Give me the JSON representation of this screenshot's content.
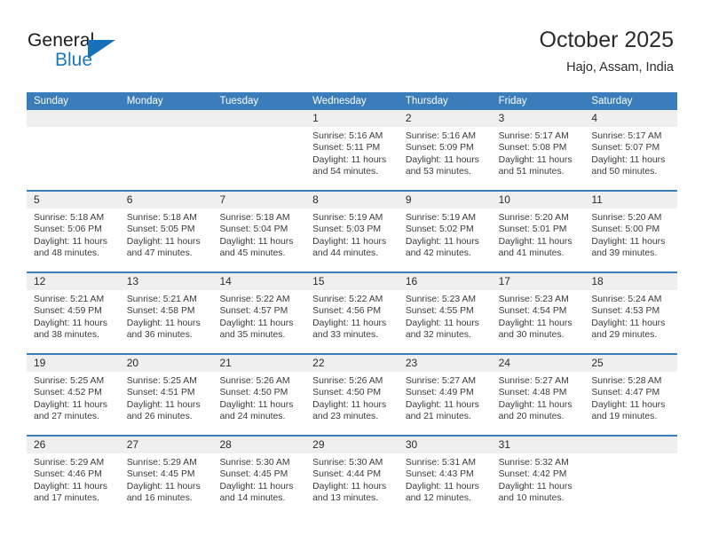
{
  "brand": {
    "name_top": "General",
    "name_bottom": "Blue",
    "accent_color": "#1571b8",
    "text_color": "#1a1a1a"
  },
  "header": {
    "title": "October 2025",
    "subtitle": "Hajo, Assam, India"
  },
  "theme": {
    "header_blue": "#3b7cba",
    "date_band_gray": "#efefef",
    "body_white": "#ffffff",
    "text_dark": "#2b2b2b",
    "text_body": "#3b3b3b"
  },
  "weekdays": [
    "Sunday",
    "Monday",
    "Tuesday",
    "Wednesday",
    "Thursday",
    "Friday",
    "Saturday"
  ],
  "labels": {
    "sunrise_prefix": "Sunrise:",
    "sunset_prefix": "Sunset:",
    "daylight_prefix": "Daylight:"
  },
  "weeks": [
    {
      "dates": [
        "",
        "",
        "",
        "1",
        "2",
        "3",
        "4"
      ],
      "cells": [
        null,
        null,
        null,
        {
          "sunrise": "Sunrise: 5:16 AM",
          "sunset": "Sunset: 5:11 PM",
          "daylight": "Daylight: 11 hours and 54 minutes."
        },
        {
          "sunrise": "Sunrise: 5:16 AM",
          "sunset": "Sunset: 5:09 PM",
          "daylight": "Daylight: 11 hours and 53 minutes."
        },
        {
          "sunrise": "Sunrise: 5:17 AM",
          "sunset": "Sunset: 5:08 PM",
          "daylight": "Daylight: 11 hours and 51 minutes."
        },
        {
          "sunrise": "Sunrise: 5:17 AM",
          "sunset": "Sunset: 5:07 PM",
          "daylight": "Daylight: 11 hours and 50 minutes."
        }
      ]
    },
    {
      "dates": [
        "5",
        "6",
        "7",
        "8",
        "9",
        "10",
        "11"
      ],
      "cells": [
        {
          "sunrise": "Sunrise: 5:18 AM",
          "sunset": "Sunset: 5:06 PM",
          "daylight": "Daylight: 11 hours and 48 minutes."
        },
        {
          "sunrise": "Sunrise: 5:18 AM",
          "sunset": "Sunset: 5:05 PM",
          "daylight": "Daylight: 11 hours and 47 minutes."
        },
        {
          "sunrise": "Sunrise: 5:18 AM",
          "sunset": "Sunset: 5:04 PM",
          "daylight": "Daylight: 11 hours and 45 minutes."
        },
        {
          "sunrise": "Sunrise: 5:19 AM",
          "sunset": "Sunset: 5:03 PM",
          "daylight": "Daylight: 11 hours and 44 minutes."
        },
        {
          "sunrise": "Sunrise: 5:19 AM",
          "sunset": "Sunset: 5:02 PM",
          "daylight": "Daylight: 11 hours and 42 minutes."
        },
        {
          "sunrise": "Sunrise: 5:20 AM",
          "sunset": "Sunset: 5:01 PM",
          "daylight": "Daylight: 11 hours and 41 minutes."
        },
        {
          "sunrise": "Sunrise: 5:20 AM",
          "sunset": "Sunset: 5:00 PM",
          "daylight": "Daylight: 11 hours and 39 minutes."
        }
      ]
    },
    {
      "dates": [
        "12",
        "13",
        "14",
        "15",
        "16",
        "17",
        "18"
      ],
      "cells": [
        {
          "sunrise": "Sunrise: 5:21 AM",
          "sunset": "Sunset: 4:59 PM",
          "daylight": "Daylight: 11 hours and 38 minutes."
        },
        {
          "sunrise": "Sunrise: 5:21 AM",
          "sunset": "Sunset: 4:58 PM",
          "daylight": "Daylight: 11 hours and 36 minutes."
        },
        {
          "sunrise": "Sunrise: 5:22 AM",
          "sunset": "Sunset: 4:57 PM",
          "daylight": "Daylight: 11 hours and 35 minutes."
        },
        {
          "sunrise": "Sunrise: 5:22 AM",
          "sunset": "Sunset: 4:56 PM",
          "daylight": "Daylight: 11 hours and 33 minutes."
        },
        {
          "sunrise": "Sunrise: 5:23 AM",
          "sunset": "Sunset: 4:55 PM",
          "daylight": "Daylight: 11 hours and 32 minutes."
        },
        {
          "sunrise": "Sunrise: 5:23 AM",
          "sunset": "Sunset: 4:54 PM",
          "daylight": "Daylight: 11 hours and 30 minutes."
        },
        {
          "sunrise": "Sunrise: 5:24 AM",
          "sunset": "Sunset: 4:53 PM",
          "daylight": "Daylight: 11 hours and 29 minutes."
        }
      ]
    },
    {
      "dates": [
        "19",
        "20",
        "21",
        "22",
        "23",
        "24",
        "25"
      ],
      "cells": [
        {
          "sunrise": "Sunrise: 5:25 AM",
          "sunset": "Sunset: 4:52 PM",
          "daylight": "Daylight: 11 hours and 27 minutes."
        },
        {
          "sunrise": "Sunrise: 5:25 AM",
          "sunset": "Sunset: 4:51 PM",
          "daylight": "Daylight: 11 hours and 26 minutes."
        },
        {
          "sunrise": "Sunrise: 5:26 AM",
          "sunset": "Sunset: 4:50 PM",
          "daylight": "Daylight: 11 hours and 24 minutes."
        },
        {
          "sunrise": "Sunrise: 5:26 AM",
          "sunset": "Sunset: 4:50 PM",
          "daylight": "Daylight: 11 hours and 23 minutes."
        },
        {
          "sunrise": "Sunrise: 5:27 AM",
          "sunset": "Sunset: 4:49 PM",
          "daylight": "Daylight: 11 hours and 21 minutes."
        },
        {
          "sunrise": "Sunrise: 5:27 AM",
          "sunset": "Sunset: 4:48 PM",
          "daylight": "Daylight: 11 hours and 20 minutes."
        },
        {
          "sunrise": "Sunrise: 5:28 AM",
          "sunset": "Sunset: 4:47 PM",
          "daylight": "Daylight: 11 hours and 19 minutes."
        }
      ]
    },
    {
      "dates": [
        "26",
        "27",
        "28",
        "29",
        "30",
        "31",
        ""
      ],
      "cells": [
        {
          "sunrise": "Sunrise: 5:29 AM",
          "sunset": "Sunset: 4:46 PM",
          "daylight": "Daylight: 11 hours and 17 minutes."
        },
        {
          "sunrise": "Sunrise: 5:29 AM",
          "sunset": "Sunset: 4:45 PM",
          "daylight": "Daylight: 11 hours and 16 minutes."
        },
        {
          "sunrise": "Sunrise: 5:30 AM",
          "sunset": "Sunset: 4:45 PM",
          "daylight": "Daylight: 11 hours and 14 minutes."
        },
        {
          "sunrise": "Sunrise: 5:30 AM",
          "sunset": "Sunset: 4:44 PM",
          "daylight": "Daylight: 11 hours and 13 minutes."
        },
        {
          "sunrise": "Sunrise: 5:31 AM",
          "sunset": "Sunset: 4:43 PM",
          "daylight": "Daylight: 11 hours and 12 minutes."
        },
        {
          "sunrise": "Sunrise: 5:32 AM",
          "sunset": "Sunset: 4:42 PM",
          "daylight": "Daylight: 11 hours and 10 minutes."
        },
        null
      ]
    }
  ]
}
